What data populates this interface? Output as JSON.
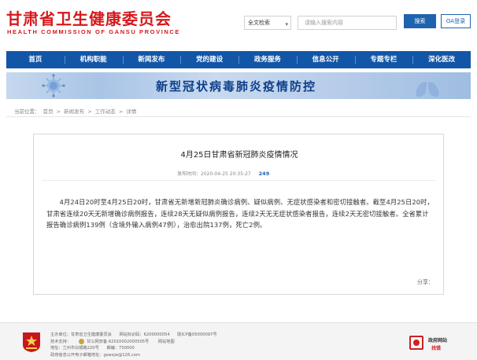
{
  "header": {
    "title_cn": "甘肃省卫生健康委员会",
    "title_en": "HEALTH COMMISSION OF GANSU PROVINCE",
    "search_scope": "全文检索",
    "search_placeholder": "请输入搜索内容",
    "search_button": "搜索",
    "oa_button": "OA登录"
  },
  "nav": {
    "items": [
      "首页",
      "机构职能",
      "新闻发布",
      "党的建设",
      "政务服务",
      "信息公开",
      "专题专栏",
      "深化医改"
    ]
  },
  "banner": {
    "text": "新型冠状病毒肺炎疫情防控"
  },
  "breadcrumb": {
    "label": "当前位置：",
    "items": [
      "首页",
      "新闻发布",
      "工作动态",
      "详情"
    ],
    "sep": " > "
  },
  "article": {
    "title": "4月25日甘肃省新冠肺炎疫情情况",
    "publish_label": "发布时间：2020-04-25 20:35:27",
    "view_count": "249",
    "body": "4月24日20时至4月25日20时，甘肃省无新增新冠肺炎确诊病例、疑似病例、无症状感染者和密切接触者。截至4月25日20时，甘肃省连续20天无新增确诊病例报告，连续28天无疑似病例报告，连续2天无无症状感染者报告，连续2天无密切接触者。全省累计报告确诊病例139例（含境外输入病例47例），治愈出院137例，死亡2例。",
    "share_label": "分享："
  },
  "footer": {
    "line1_a": "主办单位：甘肃省卫生健康委员会",
    "line1_b": "网站标识码：6200000054",
    "line1_c": "陇ICP备05000097号",
    "line2_a": "技术支持：",
    "line2_b": "甘公网安备 62010002000505号",
    "line2_c": "网站地图",
    "line3_a": "地址：兰州市白银路220号",
    "line3_b": "邮编：730000",
    "line4": "政府信息公开电子邮箱地址：gswsjw@126.com",
    "gov_line1": "政府网站",
    "gov_line2": "找错"
  },
  "colors": {
    "brand_red": "#d6191c",
    "nav_blue": "#1256a8",
    "accent_blue": "#1e63ae"
  }
}
